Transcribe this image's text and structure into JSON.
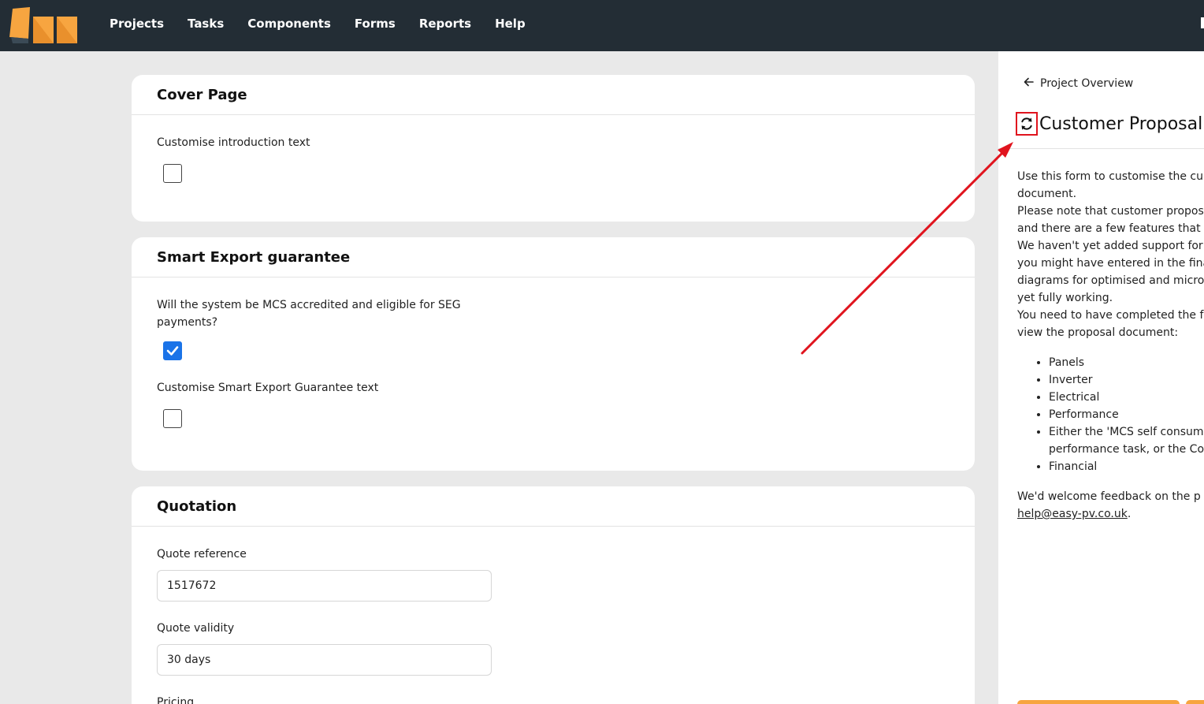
{
  "nav": {
    "items": [
      {
        "label": "Projects"
      },
      {
        "label": "Tasks"
      },
      {
        "label": "Components"
      },
      {
        "label": "Forms"
      },
      {
        "label": "Reports"
      },
      {
        "label": "Help"
      }
    ]
  },
  "cards": {
    "cover": {
      "title": "Cover Page",
      "intro_label": "Customise introduction text",
      "intro_checked": false
    },
    "seg": {
      "title": "Smart Export guarantee",
      "mcs_label": "Will the system be MCS accredited and eligible for SEG payments?",
      "mcs_checked": true,
      "seg_text_label": "Customise Smart Export Guarantee text",
      "seg_text_checked": false
    },
    "quotation": {
      "title": "Quotation",
      "ref_label": "Quote reference",
      "ref_value": "1517672",
      "validity_label": "Quote validity",
      "validity_value": "30 days",
      "pricing_label": "Pricing"
    }
  },
  "side": {
    "back_label": "Project Overview",
    "title": "Customer Proposal",
    "para1_line1": "Use this form to customise the cu",
    "para1_line2": "document.",
    "para2_line1": "Please note that customer propos",
    "para2_line2": "and there are a few features that",
    "para3_line1": "We haven't yet added support for",
    "para3_line2": "you might have entered in the fina",
    "para3_line3": "diagrams for optimised and micro",
    "para3_line4": "yet fully working.",
    "para4_line1": "You need to have completed the f",
    "para4_line2": "view the proposal document:",
    "list": [
      "Panels",
      "Inverter",
      "Electrical",
      "Performance",
      "Either the 'MCS self consum",
      "performance task, or the Co",
      "Financial"
    ],
    "feedback_line": "We'd welcome feedback on the p",
    "email": "help@easy-pv.co.uk",
    "email_suffix": "."
  },
  "colors": {
    "nav_bg": "#232d35",
    "accent_orange": "#f7a540",
    "checkbox_blue": "#1a73e8",
    "annotation_red": "#e0141e"
  }
}
